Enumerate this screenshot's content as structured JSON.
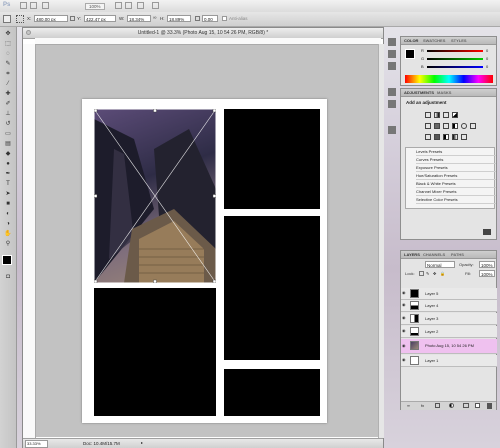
{
  "app": {
    "logo": "Ps",
    "zoom_level": "100%"
  },
  "options_bar": {
    "x_label": "X:",
    "x_value": "480.00 px",
    "y_label": "Y:",
    "y_value": "422.47 px",
    "w_label": "W:",
    "w_value": "18.34%",
    "h_label": "H:",
    "h_value": "18.89%",
    "angle_value": "0.00",
    "antialias_label": "Anti-alias"
  },
  "document": {
    "title": "Untitled-1 @ 33.3% (Photo Aug 15, 10 54 26 PM, RGB/8) *",
    "zoom": "33.33%",
    "doc_size": "Doc: 10.4M/15.7M"
  },
  "color_panel": {
    "tabs": [
      "COLOR",
      "SWATCHES",
      "STYLES"
    ],
    "channels": [
      {
        "label": "R",
        "value": "0"
      },
      {
        "label": "G",
        "value": "0"
      },
      {
        "label": "B",
        "value": "0"
      }
    ]
  },
  "adjustments_panel": {
    "tabs": [
      "ADJUSTMENTS",
      "MASKS"
    ],
    "heading": "Add an adjustment",
    "presets": [
      "Levels Presets",
      "Curves Presets",
      "Exposure Presets",
      "Hue/Saturation Presets",
      "Black & White Presets",
      "Channel Mixer Presets",
      "Selective Color Presets"
    ]
  },
  "layers_panel": {
    "tabs": [
      "LAYERS",
      "CHANNELS",
      "PATHS"
    ],
    "blend_mode": "Normal",
    "opacity_label": "Opacity:",
    "opacity_value": "100%",
    "lock_label": "Lock:",
    "fill_label": "Fill:",
    "fill_value": "100%",
    "layers": [
      {
        "name": "Layer 5",
        "selected": false
      },
      {
        "name": "Layer 4",
        "selected": false
      },
      {
        "name": "Layer 3",
        "selected": false
      },
      {
        "name": "Layer 2",
        "selected": false
      },
      {
        "name": "Photo Aug 15, 10 54 26 PM",
        "selected": true
      },
      {
        "name": "Layer 1",
        "selected": false
      }
    ]
  }
}
